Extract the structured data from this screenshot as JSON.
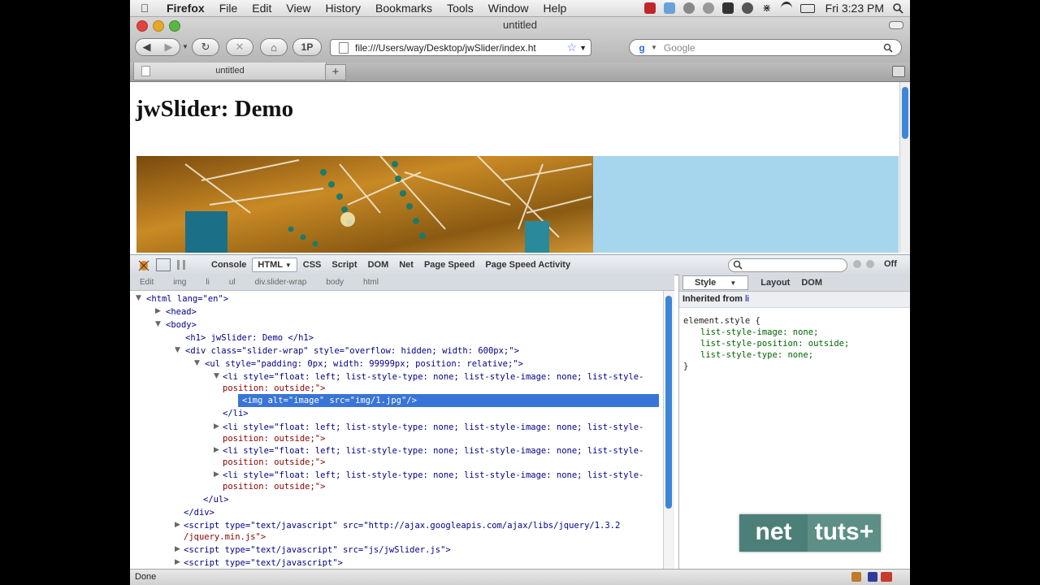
{
  "menubar": {
    "app": "Firefox",
    "items": [
      "File",
      "Edit",
      "View",
      "History",
      "Bookmarks",
      "Tools",
      "Window",
      "Help"
    ],
    "clock": "Fri 3:23 PM"
  },
  "window": {
    "title": "untitled"
  },
  "toolbar": {
    "bookmark_label": "1P",
    "url": "file:///Users/way/Desktop/jwSlider/index.ht",
    "search_placeholder": "Google"
  },
  "tabs": [
    {
      "label": "untitled"
    }
  ],
  "page": {
    "heading": "jwSlider: Demo"
  },
  "firebug": {
    "tabs": [
      "Console",
      "HTML",
      "CSS",
      "Script",
      "DOM",
      "Net",
      "Page Speed",
      "Page Speed Activity"
    ],
    "active_tab": "HTML",
    "off_label": "Off",
    "breadcrumbs": [
      "Edit",
      "img",
      "li",
      "ul",
      "div.slider-wrap",
      "body",
      "html"
    ],
    "side_tabs": [
      "Style",
      "Layout",
      "DOM"
    ],
    "inherited_label": "Inherited from",
    "inherited_tag": "li",
    "css_lines": [
      "element.style {",
      "list-style-image: none;",
      "list-style-position: outside;",
      "list-style-type: none;",
      "}"
    ]
  },
  "tree": {
    "l1": "<html lang=\"en\">",
    "l2": "<head>",
    "l3": "<body>",
    "l4": "<h1> jwSlider: Demo </h1>",
    "l5": "<div class=\"slider-wrap\" style=\"overflow: hidden; width: 600px;\">",
    "l6": "<ul style=\"padding: 0px; width: 99999px; position: relative;\">",
    "l7a": "<li style=\"float: left; list-style-type: none; list-style-image: none; list-style-",
    "l7b": "position: outside;\">",
    "l8": "<img alt=\"image\" src=\"img/1.jpg\"/>",
    "l9": "</li>",
    "l10a": "<li style=\"float: left; list-style-type: none; list-style-image: none; list-style-",
    "l10b": "position: outside;\">",
    "l11a": "<li style=\"float: left; list-style-type: none; list-style-image: none; list-style-",
    "l11b": "position: outside;\">",
    "l12a": "<li style=\"float: left; list-style-type: none; list-style-image: none; list-style-",
    "l12b": "position: outside;\">",
    "l13": "</ul>",
    "l14": "</div>",
    "l15a": "<script type=\"text/javascript\" src=\"http://ajax.googleapis.com/ajax/libs/jquery/1.3.2",
    "l15b": "/jquery.min.js\">",
    "l16": "<script type=\"text/javascript\" src=\"js/jwSlider.js\">",
    "l17": "<script type=\"text/javascript\">"
  },
  "status": {
    "text": "Done"
  },
  "watermark": {
    "left": "net",
    "right": "tuts+"
  }
}
